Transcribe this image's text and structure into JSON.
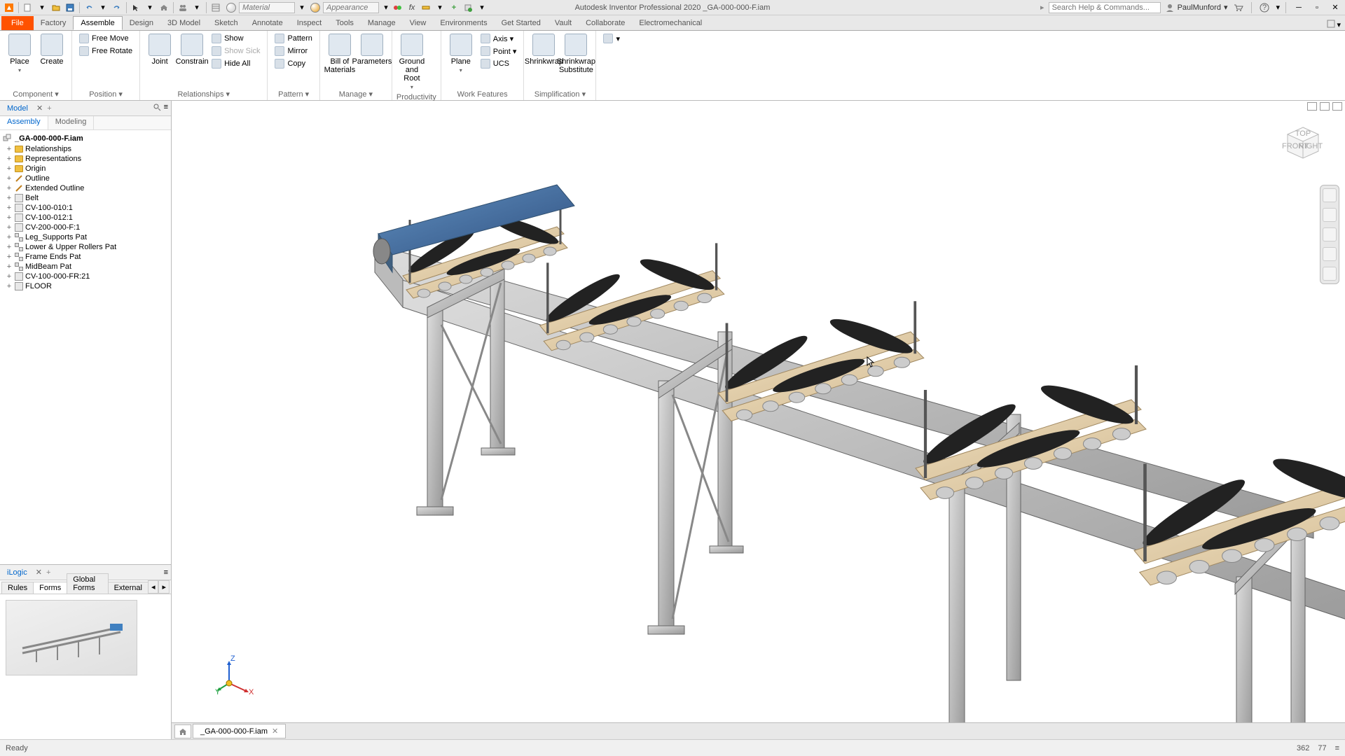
{
  "app": {
    "title": "Autodesk Inventor Professional 2020   _GA-000-000-F.iam",
    "user": "PaulMunford",
    "search_placeholder": "Search Help & Commands...",
    "material_placeholder": "Material",
    "appearance_placeholder": "Appearance"
  },
  "tabs": {
    "file": "File",
    "items": [
      "Factory",
      "Assemble",
      "Design",
      "3D Model",
      "Sketch",
      "Annotate",
      "Inspect",
      "Tools",
      "Manage",
      "View",
      "Environments",
      "Get Started",
      "Vault",
      "Collaborate",
      "Electromechanical"
    ],
    "active": "Assemble"
  },
  "ribbon": {
    "groups": [
      {
        "label": "Component ▾",
        "big": [
          {
            "t": "Place",
            "dd": true
          },
          {
            "t": "Create"
          }
        ],
        "small": []
      },
      {
        "label": "Position ▾",
        "big": [],
        "small": [
          [
            {
              "t": "Free Move"
            },
            {
              "t": "Free Rotate"
            }
          ]
        ]
      },
      {
        "label": "Relationships ▾",
        "big": [
          {
            "t": "Joint"
          },
          {
            "t": "Constrain"
          }
        ],
        "small": [
          [
            {
              "t": "Show"
            },
            {
              "t": "Show Sick",
              "disabled": true
            },
            {
              "t": "Hide All"
            }
          ]
        ]
      },
      {
        "label": "Pattern ▾",
        "big": [],
        "small": [
          [
            {
              "t": "Pattern"
            },
            {
              "t": "Mirror"
            },
            {
              "t": "Copy"
            }
          ]
        ]
      },
      {
        "label": "Manage ▾",
        "big": [
          {
            "t": "Bill of Materials"
          },
          {
            "t": "Parameters"
          }
        ],
        "small": []
      },
      {
        "label": "Productivity",
        "big": [
          {
            "t": "Ground and Root",
            "dd": true
          }
        ],
        "small": []
      },
      {
        "label": "Work Features",
        "big": [
          {
            "t": "Plane",
            "dd": true
          }
        ],
        "small": [
          [
            {
              "t": "Axis ▾"
            },
            {
              "t": "Point ▾"
            },
            {
              "t": "UCS"
            }
          ]
        ]
      },
      {
        "label": "Simplification ▾",
        "big": [
          {
            "t": "Shrinkwrap"
          },
          {
            "t": "Shrinkwrap Substitute"
          }
        ],
        "small": []
      }
    ]
  },
  "browser": {
    "panel_title": "Model",
    "subtabs": [
      "Assembly",
      "Modeling"
    ],
    "active_subtab": "Assembly",
    "root": "_GA-000-000-F.iam",
    "items": [
      {
        "label": "Relationships",
        "type": "folder"
      },
      {
        "label": "Representations",
        "type": "folder"
      },
      {
        "label": "Origin",
        "type": "folder"
      },
      {
        "label": "Outline",
        "type": "sketch"
      },
      {
        "label": "Extended Outline",
        "type": "sketch"
      },
      {
        "label": "Belt",
        "type": "part"
      },
      {
        "label": "CV-100-010:1",
        "type": "part"
      },
      {
        "label": "CV-100-012:1",
        "type": "part"
      },
      {
        "label": "CV-200-000-F:1",
        "type": "part"
      },
      {
        "label": "Leg_Supports Pat",
        "type": "pattern"
      },
      {
        "label": "Lower & Upper Rollers Pat",
        "type": "pattern"
      },
      {
        "label": "Frame Ends Pat",
        "type": "pattern"
      },
      {
        "label": "MidBeam Pat",
        "type": "pattern"
      },
      {
        "label": "CV-100-000-FR:21",
        "type": "assembly"
      },
      {
        "label": "FLOOR",
        "type": "part"
      }
    ]
  },
  "logic": {
    "title": "iLogic",
    "tabs": [
      "Rules",
      "Forms",
      "Global Forms",
      "External"
    ],
    "active_tab": "Forms"
  },
  "doc_tabs": {
    "active": "_GA-000-000-F.iam"
  },
  "status": {
    "text": "Ready",
    "coord_x": "362",
    "coord_y": "77"
  },
  "axis": {
    "x": "X",
    "y": "Y",
    "z": "Z"
  },
  "viewcube": {
    "top": "TOP",
    "front": "FRONT",
    "right": "RIGHT"
  }
}
